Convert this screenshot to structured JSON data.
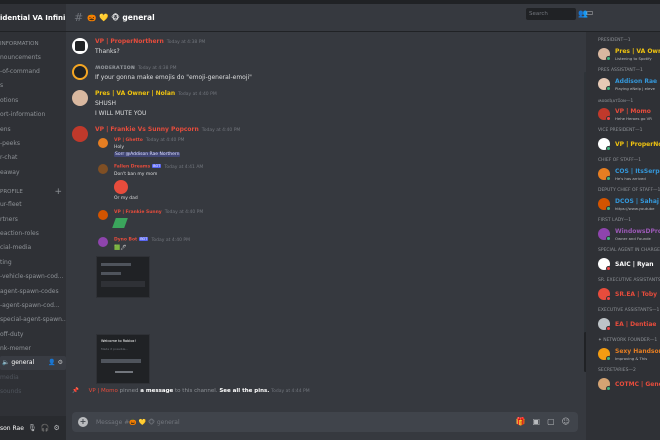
{
  "server": {
    "name": "idential VA Infini...",
    "chevron_icon": "chevron-down-icon"
  },
  "sidebar": {
    "categories": [
      {
        "label": "Information"
      },
      {
        "label": "Profile"
      }
    ],
    "channels_top": [
      {
        "label": "nouncements"
      },
      {
        "label": "-of-command"
      },
      {
        "label": "s"
      },
      {
        "label": "otions"
      },
      {
        "label": "ort-information"
      },
      {
        "label": "ens"
      },
      {
        "label": "-peeks"
      },
      {
        "label": "r-chat"
      },
      {
        "label": "eaway"
      }
    ],
    "channels_bottom": [
      {
        "label": "ur-fleet"
      },
      {
        "label": "rtners"
      },
      {
        "label": "eaction-roles"
      },
      {
        "label": "cial-media"
      },
      {
        "label": "ting"
      },
      {
        "label": "-vehicle-spawn-cod..."
      },
      {
        "label": "agent-spawn-codes"
      },
      {
        "label": "-agent-spawn-cod..."
      },
      {
        "label": "special-agent-spawn..."
      },
      {
        "label": "off-duty"
      },
      {
        "label": "nk-memer"
      }
    ],
    "active_channel": "general",
    "voice_channels": [
      {
        "label": "media"
      },
      {
        "label": "sounds"
      }
    ],
    "user_name": "son Rae"
  },
  "header": {
    "channel": "general",
    "channel_prefix": "🎃 💛 🐵",
    "search_placeholder": "Search"
  },
  "messages": [
    {
      "author": "VP | ProperNorthern",
      "color": "#e74c3c",
      "time": "Today at 4:38 PM",
      "text": "Thanks?",
      "avatar_color": "#ffffff"
    },
    {
      "author": "ʍᴏᴅᴇʀᴀᴛɪᴏɴ",
      "color": "#8e9297",
      "time": "Today at 4:38 PM",
      "text": "If your gonna make emojis do \"emoji-general-emoji\"",
      "avatar_color": "#f5a623"
    },
    {
      "author": "Pres | VA Owner | Nolan",
      "color": "#f1c40f",
      "time": "Today at 4:40 PM",
      "text": "SHUSH",
      "text2": "I WILL MUTE YOU",
      "avatar_color": "#d9b8a0"
    },
    {
      "author": "VP | Frankie Vs Sunny Popcorn",
      "color": "#e74c3c",
      "time": "Today at 4:40 PM",
      "avatar_color": "#c0392b"
    }
  ],
  "sub_messages": [
    {
      "author": "VP | Ghetto",
      "time": "Today at 4:40 PM",
      "text": "Holy",
      "text2": "Sorr @Addison Rae Northern",
      "avatar_color": "#e67e22"
    },
    {
      "author": "Fallen Dreams",
      "time": "Today at 4:41 AM",
      "bot": "BOT",
      "text": "Don't ban my mom",
      "text2": "Or my dad",
      "avatar_color": "#7f4f24"
    },
    {
      "author": "VP | Frankie Sunny",
      "time": "Today at 4:40 PM",
      "avatar_color": "#d35400"
    },
    {
      "author": "Dyno Bot",
      "time": "Today at 4:40 PM",
      "bot": "BOT",
      "avatar_color": "#8e44ad"
    }
  ],
  "embed": {
    "title": "Welcome to Roblox!",
    "sub": "Made it possible..."
  },
  "pin_notice": {
    "who": "VP | Momo",
    "mid": "pinned",
    "link": "a message",
    "end": "to this channel.",
    "see": "See all the pins.",
    "time": "Today at 4:44 PM"
  },
  "composer": {
    "placeholder": "Message #🎃 💛 🐵 general"
  },
  "members": [
    {
      "role": "PRESIDENT—1",
      "name": "Pres | VA Own",
      "color": "#f1c40f",
      "status": "Listening to Spotify",
      "av": "#d9b8a0",
      "dot": "#43b581"
    },
    {
      "role": "PRES ASSISTANT—1",
      "name": "Addison Rae",
      "color": "#3498db",
      "status": "Playing eNelp | eleve",
      "av": "#e6c9b5",
      "dot": "#43b581"
    },
    {
      "role": "ʍᴏᴅᴇʀᴀᴛɪᴏɴ—1",
      "name": "VP | Momo",
      "color": "#e74c3c",
      "status": "Hehe Heroes go VR",
      "av": "#c0392b",
      "dot": "#f04747"
    },
    {
      "role": "VICE PRESIDENT—1",
      "name": "VP | ProperNorth",
      "color": "#f1c40f",
      "status": "",
      "av": "#ffffff",
      "dot": "#43b581"
    },
    {
      "role": "CHIEF OF STAFF—1",
      "name": "COS | ItsSerpas",
      "color": "#3498db",
      "status": "He's has arrived",
      "av": "#e67e22",
      "dot": "#43b581"
    },
    {
      "role": "DEPUTY CHIEF OF STAFF—1",
      "name": "DCOS | Sahaj",
      "color": "#3498db",
      "status": "https://www.youtube",
      "av": "#d35400",
      "dot": "#43b581"
    },
    {
      "role": "FIRST LADY—1",
      "name": "WindowsDPro",
      "color": "#9b59b6",
      "status": "Owner and Founde",
      "av": "#8e44ad",
      "dot": "#43b581"
    },
    {
      "role": "SPECIAL AGENT IN CHARGE—1",
      "name": "SAIC | Ryan",
      "color": "#ffffff",
      "status": "",
      "av": "#ffffff",
      "dot": "#f04747"
    },
    {
      "role": "SR. EXECUTIVE ASSISTANTS—1",
      "name": "SR.EA | Toby",
      "color": "#e74c3c",
      "status": "",
      "av": "#e74c3c",
      "dot": "#f04747"
    },
    {
      "role": "EXECUTIVE ASSISTANTS—1",
      "name": "EA | Dentiae",
      "color": "#e74c3c",
      "status": "",
      "av": "#bdc3c7",
      "dot": "#f04747"
    },
    {
      "role": "✦ NETWORK FOUNDER—1",
      "name": "Sexy Handsome",
      "color": "#e67e22",
      "status": "Improving & This",
      "av": "#f39c12",
      "dot": "#43b581"
    },
    {
      "role": "SECRETARIES—2",
      "name": "COTMC | Genera",
      "color": "#e74c3c",
      "status": "",
      "av": "#d4a373",
      "dot": "#43b581"
    }
  ]
}
